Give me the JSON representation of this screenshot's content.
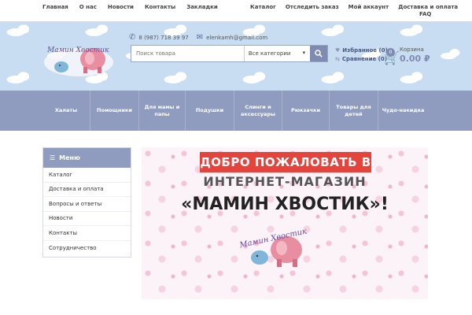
{
  "topbar": {
    "left": [
      "Главная",
      "О нас",
      "Новости",
      "Контакты",
      "Закладки"
    ],
    "right": [
      "Каталог",
      "Отследить заказ",
      "Мой аккаунт",
      "Доставка и оплата"
    ],
    "faq": "FAQ"
  },
  "header": {
    "logo_text": "Мамин Хвостик",
    "phone": "8 (987) 718 39 97",
    "email": "elenkamh@gmail.com",
    "search_placeholder": "Поиск товара",
    "category_select": "Все категории",
    "favorites": "Избранное (0)",
    "compare": "Сравнение (0)",
    "cart_label": "Корзина",
    "cart_count": "0",
    "cart_sum": "0.00 ₽"
  },
  "nav": {
    "items": [
      "Халаты",
      "Помощники",
      "Для мамы и папы",
      "Подушки",
      "Слинги и аксессуары",
      "Рюкзачки",
      "Товары для детей",
      "Чудо-накидка"
    ]
  },
  "sidebar": {
    "title": "Меню",
    "items": [
      "Каталог",
      "Доставка и оплата",
      "Вопросы и ответы",
      "Новости",
      "Контакты",
      "Сотрудничество"
    ]
  },
  "banner": {
    "welcome": "ДОБРО ПОЖАЛОВАТЬ В",
    "subtitle": "ИНТЕРНЕТ-МАГАЗИН",
    "brand": "«МАМИН ХВОСТИК»!",
    "logo_text": "Мамин Хвостик"
  },
  "colors": {
    "accent": "#8f9cc0",
    "welcome_red": "#e5443d",
    "header_sky": "#c9ddf2"
  }
}
